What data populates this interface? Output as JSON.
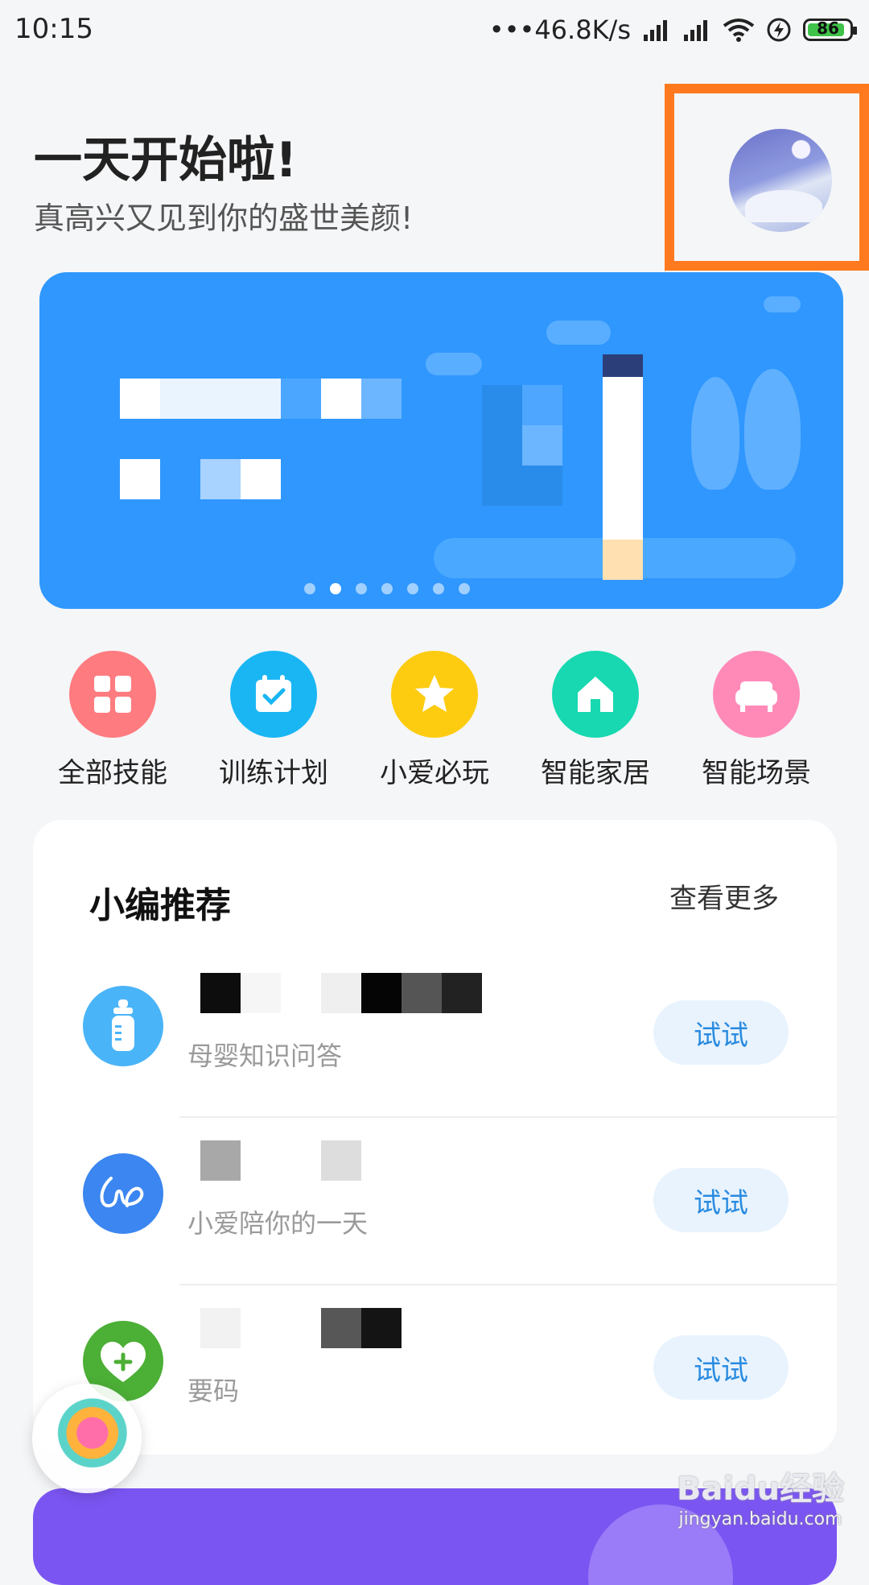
{
  "status_bar": {
    "time": "10:15",
    "network_speed": "•••46.8K/s",
    "battery": "86"
  },
  "greeting": {
    "title": "一天开始啦!",
    "subtitle": "真高兴又见到你的盛世美颜!"
  },
  "banner": {
    "page_count": 7,
    "active_index": 1
  },
  "quick_actions": [
    {
      "label": "全部技能",
      "icon": "grid-icon",
      "color": "#fe7b7f"
    },
    {
      "label": "训练计划",
      "icon": "calendar-check-icon",
      "color": "#1ab6f4"
    },
    {
      "label": "小爱必玩",
      "icon": "star-icon",
      "color": "#fdcc11"
    },
    {
      "label": "智能家居",
      "icon": "home-icon",
      "color": "#17d8b0"
    },
    {
      "label": "智能场景",
      "icon": "sofa-icon",
      "color": "#ff8ab8"
    }
  ],
  "recommend": {
    "title": "小编推荐",
    "more": "查看更多",
    "items": [
      {
        "subtitle": "母婴知识问答",
        "button": "试试",
        "icon": "baby-bottle-icon",
        "icon_color": "#4ab4f8"
      },
      {
        "subtitle": "小爱陪你的一天",
        "button": "试试",
        "icon": "signature-icon",
        "icon_color": "#3b86f0"
      },
      {
        "subtitle": "要码",
        "button": "试试",
        "icon": "heart-plus-icon",
        "icon_color": "#4caf36"
      }
    ]
  },
  "watermark": {
    "logo": "Baidu经验",
    "url": "jingyan.baidu.com"
  }
}
